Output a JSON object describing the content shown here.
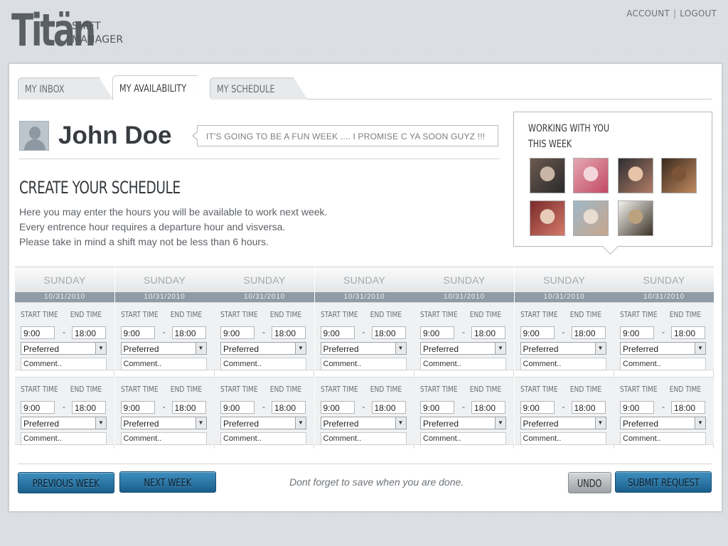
{
  "brand": {
    "logo_text": "Titän",
    "sub_line1": "SHIFT",
    "sub_line2": "MANAGER"
  },
  "top_links": {
    "account": "ACCOUNT",
    "separator": "|",
    "logout": "LOGOUT"
  },
  "tabs": [
    {
      "label": "MY INBOX",
      "active": false
    },
    {
      "label": "MY AVAILABILITY",
      "active": true
    },
    {
      "label": "MY SCHEDULE",
      "active": false
    }
  ],
  "profile": {
    "name": "John Doe",
    "status": "IT'S GOING TO BE A FUN WEEK .... I PROMISE C YA SOON GUYZ !!!"
  },
  "schedule": {
    "title": "CREATE YOUR SCHEDULE",
    "instructions": [
      "Here you may enter the hours you will be available to work next week.",
      "Every entrence hour requires a departure hour and visversa.",
      "Please take in mind a shift may not be less than 6 hours."
    ],
    "days": [
      {
        "day": "SUNDAY",
        "date": "10/31/2010"
      },
      {
        "day": "SUNDAY",
        "date": "10/31/2010"
      },
      {
        "day": "SUNDAY",
        "date": "10/31/2010"
      },
      {
        "day": "SUNDAY",
        "date": "10/31/2010"
      },
      {
        "day": "SUNDAY",
        "date": "10/31/2010"
      },
      {
        "day": "SUNDAY",
        "date": "10/31/2010"
      },
      {
        "day": "SUNDAY",
        "date": "10/31/2010"
      }
    ],
    "shift_labels": {
      "start": "START TIME",
      "end": "END TIME",
      "dash": "-"
    },
    "shift_defaults": {
      "start": "9:00",
      "end": "18:00",
      "preference": "Preferred",
      "comment": "Comment.."
    }
  },
  "coworkers": {
    "title_line1": "WORKING WITH YOU",
    "title_line2": "THIS WEEK",
    "photos": [
      {
        "name": "coworker-photo-1",
        "colors": [
          "#6b5a4f",
          "#2b2a2c",
          "#c9b5a5"
        ]
      },
      {
        "name": "coworker-photo-2",
        "colors": [
          "#e6a7b3",
          "#c14a63",
          "#f3d6db"
        ]
      },
      {
        "name": "coworker-photo-3",
        "colors": [
          "#2d2d30",
          "#b07d67",
          "#e7c4a8"
        ]
      },
      {
        "name": "coworker-photo-4",
        "colors": [
          "#3b2a1e",
          "#c08a5f",
          "#7d5436"
        ]
      },
      {
        "name": "coworker-photo-5",
        "colors": [
          "#7a2a2a",
          "#d47a6a",
          "#e6ccb9"
        ]
      },
      {
        "name": "coworker-photo-6",
        "colors": [
          "#9fb7c7",
          "#c7a58d",
          "#e8ddd1"
        ]
      },
      {
        "name": "coworker-photo-7",
        "colors": [
          "#f2f2ee",
          "#3d3328",
          "#bba27e"
        ]
      }
    ]
  },
  "footer": {
    "prev_week": "PREVIOUS WEEK",
    "next_week": "NEXT WEEK",
    "save_note": "Dont forget to save when you are done.",
    "undo": "UNDO",
    "submit": "SUBMIT REQUEST"
  },
  "colors": {
    "button_blue": "#2a74a5",
    "date_bar": "#8f9ba5",
    "button_gray": "#b8bbbe"
  }
}
